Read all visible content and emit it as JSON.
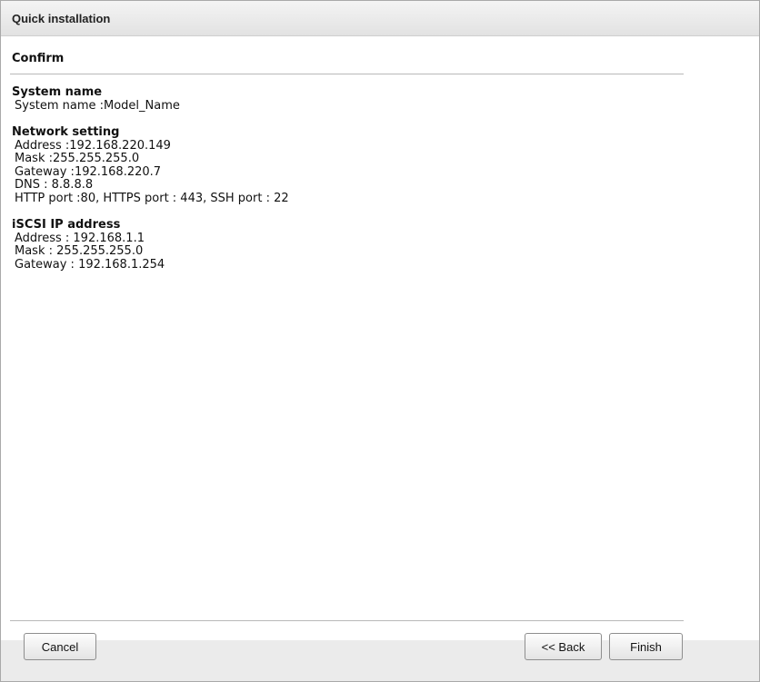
{
  "window": {
    "title": "Quick installation"
  },
  "confirm": {
    "heading": "Confirm",
    "groups": [
      {
        "heading": "System name",
        "lines": [
          "System name :Model_Name"
        ]
      },
      {
        "heading": "Network setting",
        "lines": [
          "Address :192.168.220.149",
          "Mask :255.255.255.0",
          "Gateway :192.168.220.7",
          "DNS : 8.8.8.8",
          "HTTP port :80, HTTPS port : 443, SSH port : 22"
        ]
      },
      {
        "heading": "iSCSI IP address",
        "lines": [
          "Address : 192.168.1.1",
          "Mask : 255.255.255.0",
          "Gateway : 192.168.1.254"
        ]
      }
    ]
  },
  "buttons": {
    "cancel": "Cancel",
    "back": "<< Back",
    "finish": "Finish"
  }
}
